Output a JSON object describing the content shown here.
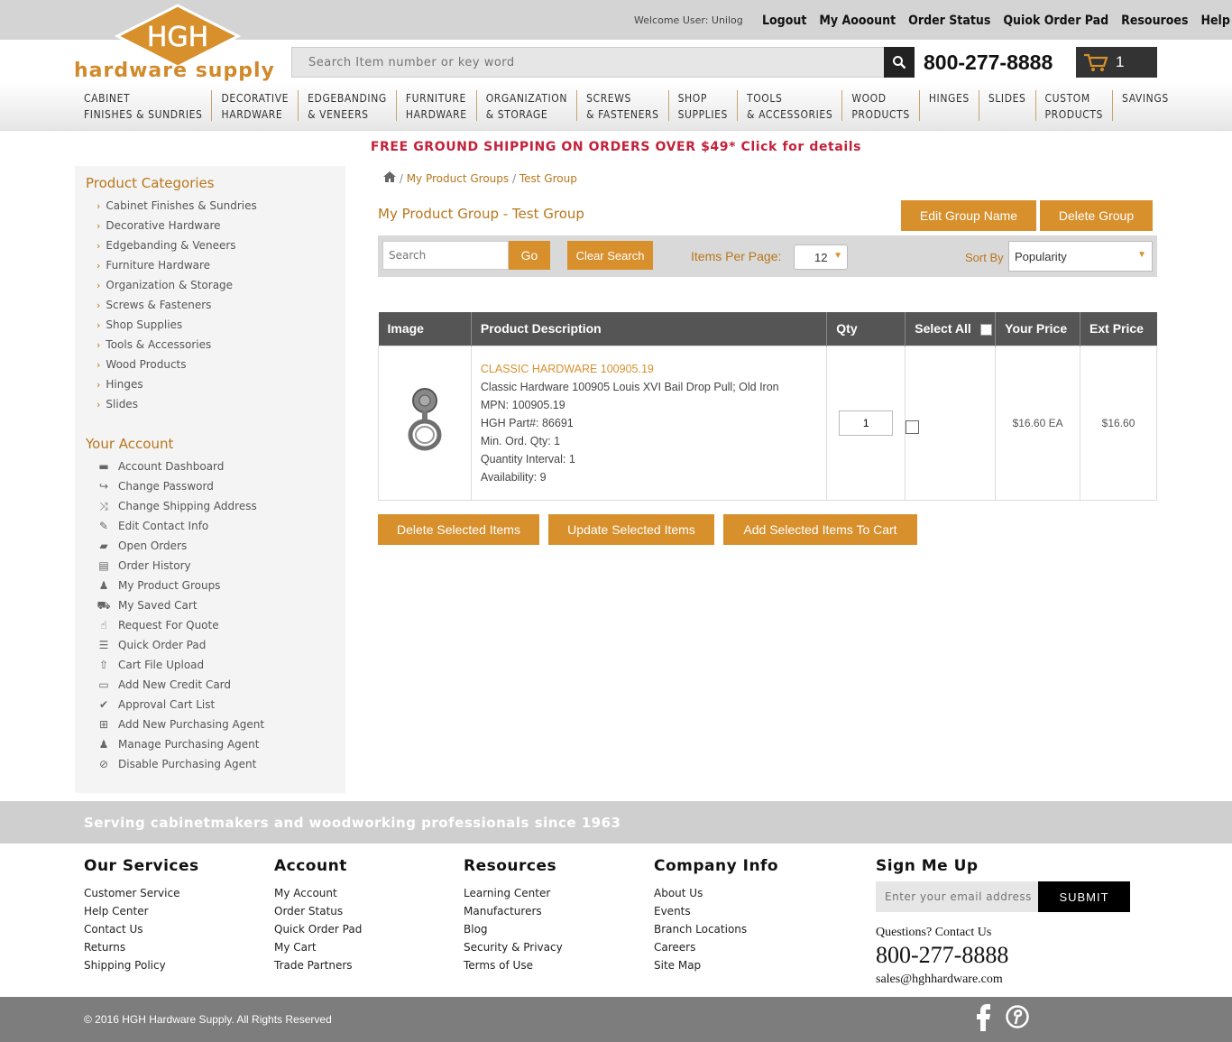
{
  "header": {
    "welcome": "Welcome User: Unilog",
    "links": [
      "Logout",
      "My Aooount",
      "Order Status",
      "Quiok Order Pad",
      "Resouroes",
      "Help"
    ],
    "logo_mark": "HGH",
    "logo_text": "hardware supply",
    "search_placeholder": "Search Item number or key word",
    "phone": "800-277-8888",
    "cart_count": "1"
  },
  "nav": [
    {
      "l1": "CABINET",
      "l2": "FINISHES & SUNDRIES"
    },
    {
      "l1": "DECORATIVE",
      "l2": "HARDWARE"
    },
    {
      "l1": "EDGEBANDING",
      "l2": "& VENEERS"
    },
    {
      "l1": "FURNITURE",
      "l2": "HARDWARE"
    },
    {
      "l1": "ORGANIZATION",
      "l2": "& STORAGE"
    },
    {
      "l1": "SCREWS",
      "l2": "& FASTENERS"
    },
    {
      "l1": "SHOP",
      "l2": "SUPPLIES"
    },
    {
      "l1": "TOOLS",
      "l2": "& ACCESSORIES"
    },
    {
      "l1": "WOOD",
      "l2": "PRODUCTS"
    },
    {
      "l1": "HINGES",
      "l2": ""
    },
    {
      "l1": "SLIDES",
      "l2": ""
    },
    {
      "l1": "CUSTOM",
      "l2": "PRODUCTS"
    },
    {
      "l1": "SAVINGS",
      "l2": ""
    }
  ],
  "promo": "FREE GROUND SHIPPING ON ORDERS OVER $49* Click for details",
  "sidebar": {
    "categories_title": "Product Categories",
    "categories": [
      "Cabinet Finishes & Sundries",
      "Decorative Hardware",
      "Edgebanding & Veneers",
      "Furniture Hardware",
      "Organization & Storage",
      "Screws & Fasteners",
      "Shop Supplies",
      "Tools & Accessories",
      "Wood Products",
      "Hinges",
      "Slides"
    ],
    "account_title": "Your Account",
    "account": [
      {
        "label": "Account Dashboard",
        "icon": "dashboard-icon",
        "glyph": "▬"
      },
      {
        "label": "Change Password",
        "icon": "share-icon",
        "glyph": "↪"
      },
      {
        "label": "Change Shipping Address",
        "icon": "shuffle-icon",
        "glyph": "⤨"
      },
      {
        "label": "Edit Contact Info",
        "icon": "pencil-icon",
        "glyph": "✎"
      },
      {
        "label": "Open Orders",
        "icon": "folder-open-icon",
        "glyph": "▰"
      },
      {
        "label": "Order History",
        "icon": "book-icon",
        "glyph": "▤"
      },
      {
        "label": "My Product Groups",
        "icon": "users-icon",
        "glyph": "♟"
      },
      {
        "label": "My Saved Cart",
        "icon": "cart-icon",
        "glyph": "⛟"
      },
      {
        "label": "Request For Quote",
        "icon": "thumbs-up-icon",
        "glyph": "☝"
      },
      {
        "label": "Quick Order Pad",
        "icon": "list-icon",
        "glyph": "☰"
      },
      {
        "label": "Cart File Upload",
        "icon": "upload-icon",
        "glyph": "⇧"
      },
      {
        "label": "Add New Credit Card",
        "icon": "credit-card-icon",
        "glyph": "▭"
      },
      {
        "label": "Approval Cart List",
        "icon": "check-icon",
        "glyph": "✔"
      },
      {
        "label": "Add New Purchasing Agent",
        "icon": "plus-square-icon",
        "glyph": "⊞"
      },
      {
        "label": "Manage Purchasing Agent",
        "icon": "users-icon",
        "glyph": "♟"
      },
      {
        "label": "Disable Purchasing Agent",
        "icon": "ban-icon",
        "glyph": "⊘"
      }
    ]
  },
  "breadcrumb": {
    "items": [
      "My Product Groups",
      "Test Group"
    ],
    "sep": "/"
  },
  "page": {
    "title": "My Product Group - Test Group",
    "edit_btn": "Edit Group Name",
    "delete_btn": "Delete Group"
  },
  "filter": {
    "search_placeholder": "Search",
    "go": "Go",
    "clear": "Clear Search",
    "per_page_label": "Items Per Page:",
    "per_page_value": "12",
    "sort_label": "Sort By",
    "sort_value": "Popularity"
  },
  "table": {
    "headers": [
      "Image",
      "Product Description",
      "Qty",
      "Select All",
      "Your Price",
      "Ext Price"
    ],
    "row": {
      "title": "CLASSIC HARDWARE 100905.19",
      "desc": "Classic Hardware 100905 Louis XVI Bail Drop Pull; Old Iron",
      "mpn": "MPN: 100905.19",
      "part": "HGH Part#: 86691",
      "min": "Min. Ord. Qty: 1",
      "interval": "Quantity Interval: 1",
      "avail": "Availability: 9",
      "qty": "1",
      "price": "$16.60 EA",
      "ext": "$16.60"
    }
  },
  "actions": [
    "Delete Selected Items",
    "Update Selected Items",
    "Add Selected Items To Cart"
  ],
  "footer": {
    "tagline": "Serving cabinetmakers and woodworking professionals since 1963",
    "cols": [
      {
        "title": "Our Services",
        "items": [
          "Customer Service",
          "Help Center",
          "Contact Us",
          "Returns",
          "Shipping Policy"
        ]
      },
      {
        "title": "Account",
        "items": [
          "My Account",
          "Order Status",
          "Quick Order Pad",
          "My Cart",
          "Trade Partners"
        ]
      },
      {
        "title": "Resources",
        "items": [
          "Learning Center",
          "Manufacturers",
          "Blog",
          "Security & Privacy",
          "Terms of Use"
        ]
      },
      {
        "title": "Company Info",
        "items": [
          "About Us",
          "Events",
          "Branch Locations",
          "Careers",
          "Site Map"
        ]
      }
    ],
    "signup_title": "Sign Me Up",
    "email_placeholder": "Enter your email address",
    "submit": "SUBMIT",
    "questions": "Questions? Contact Us",
    "phone": "800-277-8888",
    "email": "sales@hghhardware.com",
    "copyright": "© 2016 HGH Hardware Supply. All Rights Reserved"
  },
  "colors": {
    "accent": "#d8902d",
    "brand_text": "#b8761c",
    "promo": "#c4213a"
  }
}
